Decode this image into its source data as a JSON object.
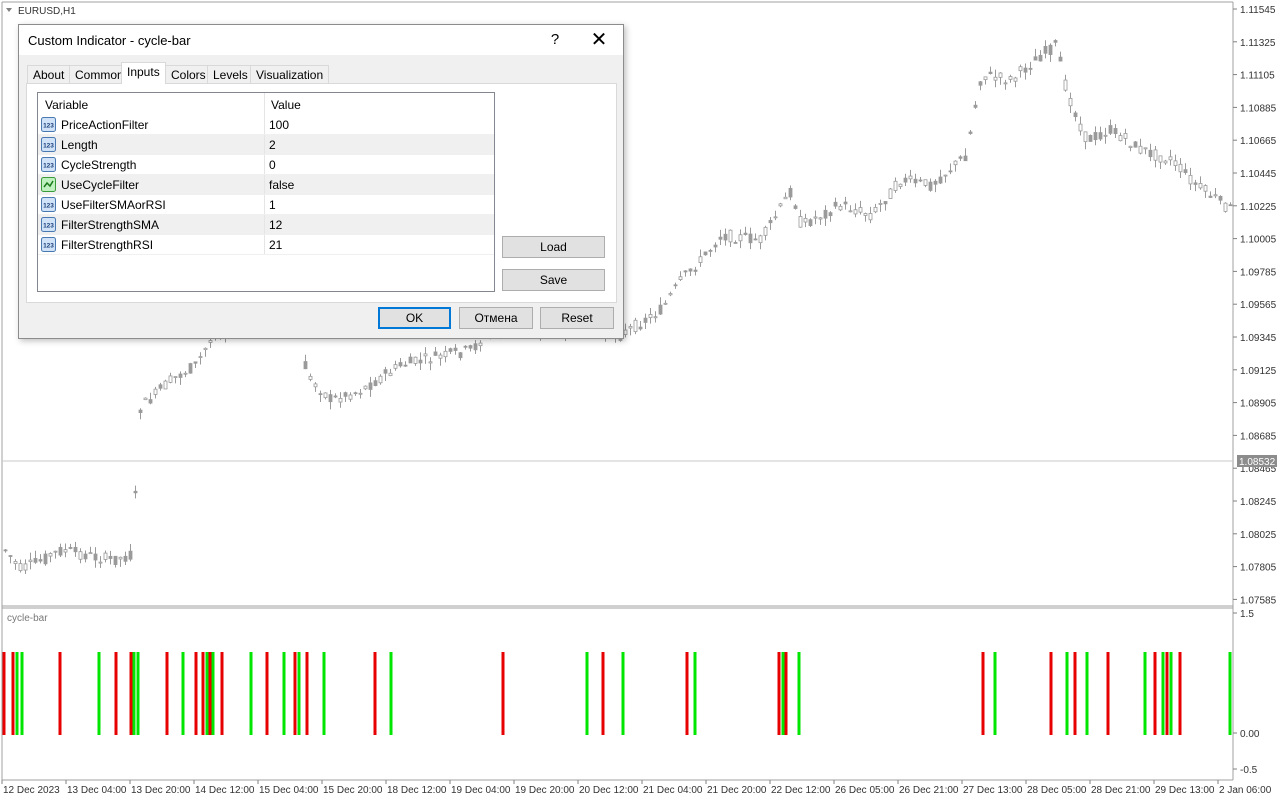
{
  "chart": {
    "symbol_label": "EURUSD,H1",
    "price_axis": [
      "1.11545",
      "1.11325",
      "1.11105",
      "1.10885",
      "1.10665",
      "1.10445",
      "1.10225",
      "1.10005",
      "1.09785",
      "1.09565",
      "1.09345",
      "1.09125",
      "1.08905",
      "1.08685",
      "1.08465",
      "1.08245",
      "1.08025",
      "1.07805",
      "1.07585"
    ],
    "current_price": "1.08532",
    "time_axis": [
      "12 Dec 2023",
      "13 Dec 04:00",
      "13 Dec 20:00",
      "14 Dec 12:00",
      "15 Dec 04:00",
      "15 Dec 20:00",
      "18 Dec 12:00",
      "19 Dec 04:00",
      "19 Dec 20:00",
      "20 Dec 12:00",
      "21 Dec 04:00",
      "21 Dec 20:00",
      "22 Dec 12:00",
      "26 Dec 05:00",
      "26 Dec 21:00",
      "27 Dec 13:00",
      "28 Dec 05:00",
      "28 Dec 21:00",
      "29 Dec 13:00",
      "2 Jan 06:00"
    ],
    "colors": {
      "candle": "#9a9a9a",
      "bull_bar": "#00e600",
      "bear_bar": "#e60000",
      "price_tag_bg": "#8c8c8c"
    }
  },
  "indicator": {
    "name": "cycle-bar",
    "axis": [
      "1.5",
      "0.00",
      "-0.5"
    ]
  },
  "dialog": {
    "title": "Custom Indicator - cycle-bar",
    "help_label": "?",
    "close_label": "✕",
    "tabs": [
      {
        "label": "About"
      },
      {
        "label": "Common"
      },
      {
        "label": "Inputs"
      },
      {
        "label": "Colors"
      },
      {
        "label": "Levels"
      },
      {
        "label": "Visualization"
      }
    ],
    "active_tab": "Inputs",
    "columns": [
      "Variable",
      "Value"
    ],
    "rows": [
      {
        "name": "PriceActionFilter",
        "value": "100",
        "icon": "numeric-icon"
      },
      {
        "name": "Length",
        "value": "2",
        "icon": "numeric-icon"
      },
      {
        "name": "CycleStrength",
        "value": "0",
        "icon": "numeric-icon"
      },
      {
        "name": "UseCycleFilter",
        "value": "false",
        "icon": "boolean-icon"
      },
      {
        "name": "UseFilterSMAorRSI",
        "value": "1",
        "icon": "numeric-icon"
      },
      {
        "name": "FilterStrengthSMA",
        "value": "12",
        "icon": "numeric-icon"
      },
      {
        "name": "FilterStrengthRSI",
        "value": "21",
        "icon": "numeric-icon"
      }
    ],
    "load_label": "Load",
    "save_label": "Save",
    "ok_label": "OK",
    "cancel_label": "Отмена",
    "reset_label": "Reset"
  }
}
